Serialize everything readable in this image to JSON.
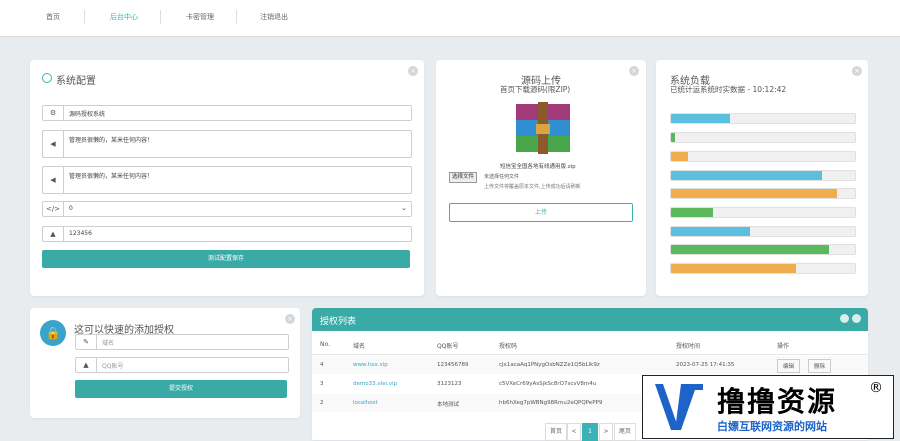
{
  "nav": {
    "items": [
      "首页",
      "后台中心",
      "卡密管理",
      "注销退出"
    ]
  },
  "config": {
    "title": "系统配置",
    "field1": "源码授权系统",
    "field2": "管理员很懒的，某米任何内容！",
    "field3": "管理员很懒的，某米任何内容！",
    "select_value": "0",
    "field5": "123456",
    "save_label": "测试配置保存"
  },
  "upload": {
    "title": "源码上传",
    "subtitle": "首页下载源码(限ZIP)",
    "filename": "短信宝全国各地有线通用版.zip",
    "choose_label": "选择文件",
    "no_file": "未选择任何文件",
    "hint": "上传文件将覆盖原本文件,上传成功后请刷新",
    "submit_label": "上传"
  },
  "load": {
    "title": "系统负载",
    "subtitle": "已统计运系统时实数据 - 10:12:42",
    "bars": [
      {
        "value": 0.32,
        "color": "#5bc0de"
      },
      {
        "value": 0.02,
        "color": "#5cb85c"
      },
      {
        "value": 0.09,
        "color": "#f0ad4e"
      },
      {
        "value": 0.82,
        "color": "#5bc0de"
      },
      {
        "value": 0.9,
        "color": "#f0ad4e"
      },
      {
        "value": 0.23,
        "color": "#5cb85c"
      },
      {
        "value": 0.43,
        "color": "#5bc0de"
      },
      {
        "value": 0.86,
        "color": "#5cb85c"
      },
      {
        "value": 0.68,
        "color": "#f0ad4e"
      }
    ]
  },
  "auth": {
    "title": "这可以快速的添加授权",
    "field1_placeholder": "域名",
    "field2_placeholder": "QQ账号",
    "submit_label": "提交授权"
  },
  "list": {
    "title": "授权列表",
    "headers": [
      "No.",
      "域名",
      "QQ账号",
      "授权码",
      "授权时间",
      "操作"
    ],
    "rows": [
      {
        "no": "4",
        "domain": "www.hxx.vip",
        "qq": "123456789",
        "code": "cJx1acaAq1PNygOsbNZZe1Q5bLlk9z",
        "time": "2023-07-25 17:41:35",
        "edit": "编辑",
        "del": "删除"
      },
      {
        "no": "3",
        "domain": "demo33.vlei.vip",
        "qq": "3123123",
        "code": "c5VXeCr69yAsSjkSc8rO7scvV8m4u",
        "time": "",
        "edit": "",
        "del": ""
      },
      {
        "no": "2",
        "domain": "localhost",
        "qq": "本地测试",
        "code": "hb6hXeg7pWBNg98Rmu2eQPQPePP9",
        "time": "",
        "edit": "",
        "del": ""
      }
    ],
    "pages": [
      "首页",
      "<",
      "1",
      ">",
      "尾页"
    ]
  },
  "watermark": {
    "brand": "撸撸资源",
    "tagline": "白嫖互联网资源的网站",
    "mark": "®"
  }
}
